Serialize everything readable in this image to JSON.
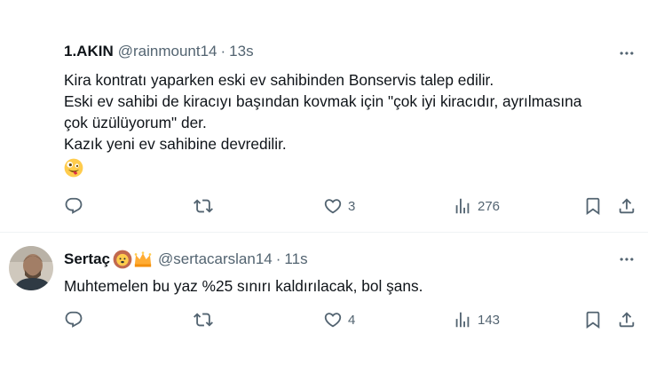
{
  "tweets": [
    {
      "name": "1.AKIN",
      "handle": "@rainmount14",
      "separator": "·",
      "time": "13s",
      "lines": [
        "Kira kontratı yaparken eski ev sahibinden Bonservis talep edilir.",
        "Eski ev sahibi de kiracıyı başından kovmak için \"çok iyi kiracıdır, ayrılmasına",
        "çok üzülüyorum\" der.",
        "Kazık yeni ev sahibine devredilir."
      ],
      "emoji": "zany-face-emoji",
      "reply_count": "",
      "retweet_count": "",
      "like_count": "3",
      "view_count": "276"
    },
    {
      "name": "Sertaç",
      "badges": [
        "lion-emoji",
        "crown-emoji"
      ],
      "handle": "@sertacarslan14",
      "separator": "·",
      "time": "11s",
      "lines": [
        "Muhtemelen bu yaz %25 sınırı kaldırılacak, bol şans."
      ],
      "reply_count": "",
      "retweet_count": "",
      "like_count": "4",
      "view_count": "143"
    }
  ],
  "colors": {
    "text": "#0f1419",
    "secondary": "#536471",
    "divider": "#eff3f4"
  },
  "icons": [
    "reply-icon",
    "retweet-icon",
    "like-icon",
    "views-icon",
    "bookmark-icon",
    "share-icon",
    "more-icon"
  ]
}
